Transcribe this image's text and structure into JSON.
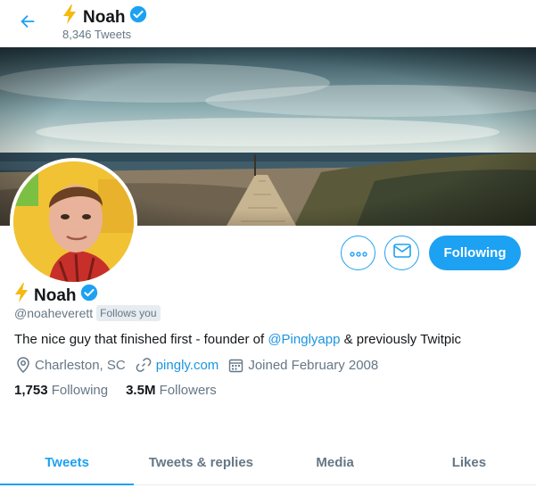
{
  "header": {
    "name": "Noah",
    "tweet_count": "8,346 Tweets"
  },
  "profile": {
    "name": "Noah",
    "handle": "@noaheverett",
    "follows_you": "Follows you",
    "bio_before": "The nice guy that finished first - founder of ",
    "bio_mention": "@Pinglyapp",
    "bio_after": " & previously Twitpic",
    "location": "Charleston, SC",
    "website": "pingly.com",
    "joined": "Joined February 2008",
    "following_count": "1,753",
    "following_label": "Following",
    "followers_count": "3.5M",
    "followers_label": "Followers"
  },
  "actions": {
    "follow_label": "Following"
  },
  "tabs": [
    {
      "label": "Tweets",
      "active": true
    },
    {
      "label": "Tweets & replies",
      "active": false
    },
    {
      "label": "Media",
      "active": false
    },
    {
      "label": "Likes",
      "active": false
    }
  ],
  "colors": {
    "accent": "#1da1f2",
    "link": "#1b95e0",
    "muted": "#657786",
    "bolt": "#f5b90f"
  },
  "icons": {
    "back": "arrow-left-icon",
    "bolt": "lightning-bolt-icon",
    "verified": "verified-badge-icon",
    "more": "more-dots-icon",
    "message": "envelope-icon",
    "location": "location-pin-icon",
    "link": "link-icon",
    "calendar": "calendar-icon"
  }
}
